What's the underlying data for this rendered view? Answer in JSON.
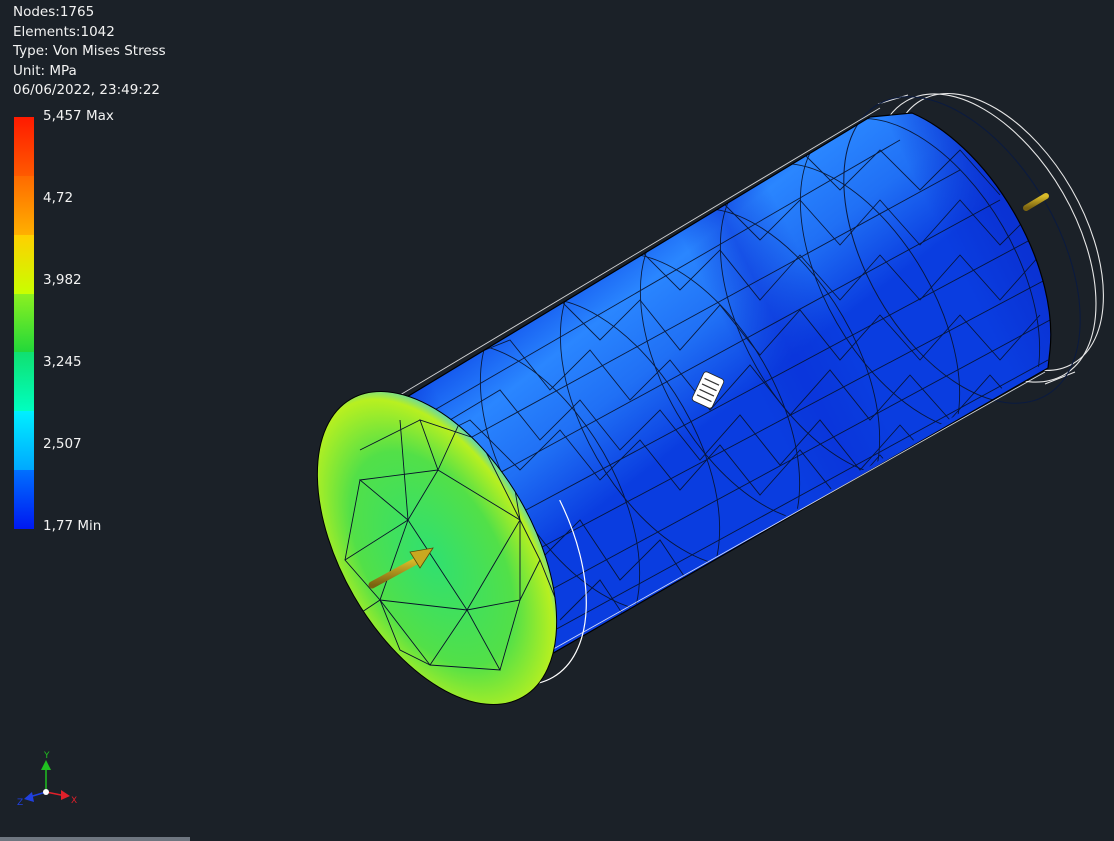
{
  "info": {
    "nodes": "Nodes:1765",
    "elements": "Elements:1042",
    "type": "Type: Von Mises Stress",
    "unit": "Unit: MPa",
    "datetime": "06/06/2022, 23:49:22"
  },
  "legend": {
    "labels": [
      "5,457 Max",
      "4,72",
      "3,982",
      "3,245",
      "2,507",
      "1,77 Min"
    ],
    "colors": [
      "#ff1a00",
      "#ff8c00",
      "#ffff00",
      "#22dd22",
      "#00ffb0",
      "#00e0ff",
      "#0040ff"
    ]
  },
  "axes": {
    "x_label": "X",
    "y_label": "Y",
    "z_label": "Z",
    "x_color": "#e0202a",
    "y_color": "#20c020",
    "z_color": "#2040e0"
  },
  "model": {
    "body_color": "#1a6cf0",
    "face_color": "#3fd84a",
    "arrow_color": "#b89a18"
  }
}
